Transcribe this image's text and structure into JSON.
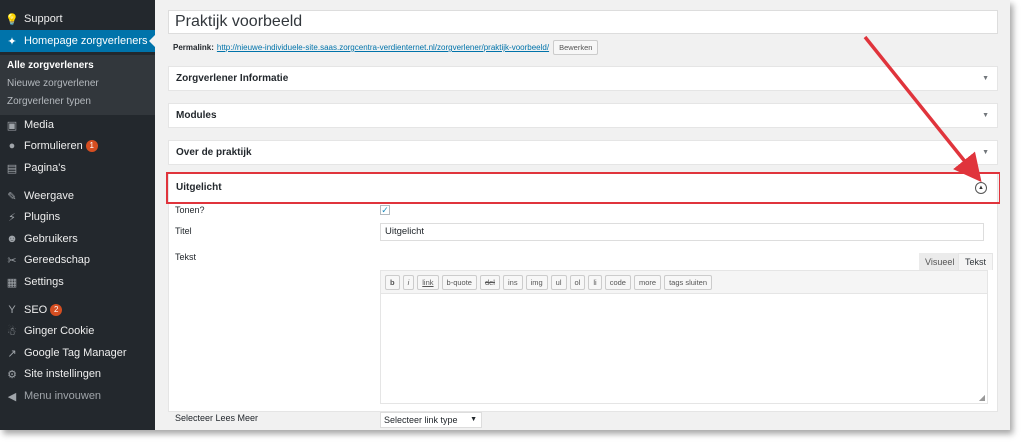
{
  "sidebar": {
    "items": [
      {
        "label": "Support",
        "icon": "lightbulb-icon",
        "glyph": "💡"
      },
      {
        "label": "Homepage zorgverleners",
        "icon": "person-icon",
        "glyph": "✦"
      },
      {
        "label": "Media",
        "icon": "media-icon",
        "glyph": "▣"
      },
      {
        "label": "Formulieren",
        "icon": "forms-icon",
        "glyph": "●",
        "badge": "1"
      },
      {
        "label": "Pagina's",
        "icon": "pages-icon",
        "glyph": "▤"
      },
      {
        "label": "Weergave",
        "icon": "brush-icon",
        "glyph": "✎"
      },
      {
        "label": "Plugins",
        "icon": "plug-icon",
        "glyph": "⚡"
      },
      {
        "label": "Gebruikers",
        "icon": "users-icon",
        "glyph": "☻"
      },
      {
        "label": "Gereedschap",
        "icon": "wrench-icon",
        "glyph": "✂"
      },
      {
        "label": "Settings",
        "icon": "settings-icon",
        "glyph": "▦"
      },
      {
        "label": "SEO",
        "icon": "seo-icon",
        "glyph": "Y",
        "badge": "2"
      },
      {
        "label": "Ginger Cookie",
        "icon": "cookie-icon",
        "glyph": "☃"
      },
      {
        "label": "Google Tag Manager",
        "icon": "chart-icon",
        "glyph": "↗"
      },
      {
        "label": "Site instellingen",
        "icon": "gear-icon",
        "glyph": "⚙"
      },
      {
        "label": "Menu invouwen",
        "icon": "collapse-icon",
        "glyph": "◀"
      }
    ],
    "submenu": [
      "Alle zorgverleners",
      "Nieuwe zorgverlener",
      "Zorgverlener typen"
    ]
  },
  "post": {
    "title": "Praktijk voorbeeld",
    "permalink_label": "Permalink:",
    "permalink_url": "http://nieuwe-individuele-site.saas.zorgcentra-verdienternet.nl/zorgverlener/praktijk-voorbeeld/",
    "edit_button": "Bewerken"
  },
  "boxes": {
    "zorgverlener": "Zorgverlener Informatie",
    "modules": "Modules",
    "over": "Over de praktijk",
    "uitgelicht": "Uitgelicht"
  },
  "fields": {
    "tonen_label": "Tonen?",
    "titel_label": "Titel",
    "titel_value": "Uitgelicht",
    "tekst_label": "Tekst",
    "tab_visual": "Visueel",
    "tab_text": "Tekst",
    "quicktags": [
      "b",
      "i",
      "link",
      "b-quote",
      "del",
      "ins",
      "img",
      "ul",
      "ol",
      "li",
      "code",
      "more",
      "tags sluiten"
    ],
    "lees_meer_label": "Selecteer Lees Meer",
    "lees_meer_value": "Selecteer link type"
  },
  "colors": {
    "sidebar_bg": "#23282d",
    "active_bg": "#0073aa",
    "highlight": "#e0343c"
  }
}
